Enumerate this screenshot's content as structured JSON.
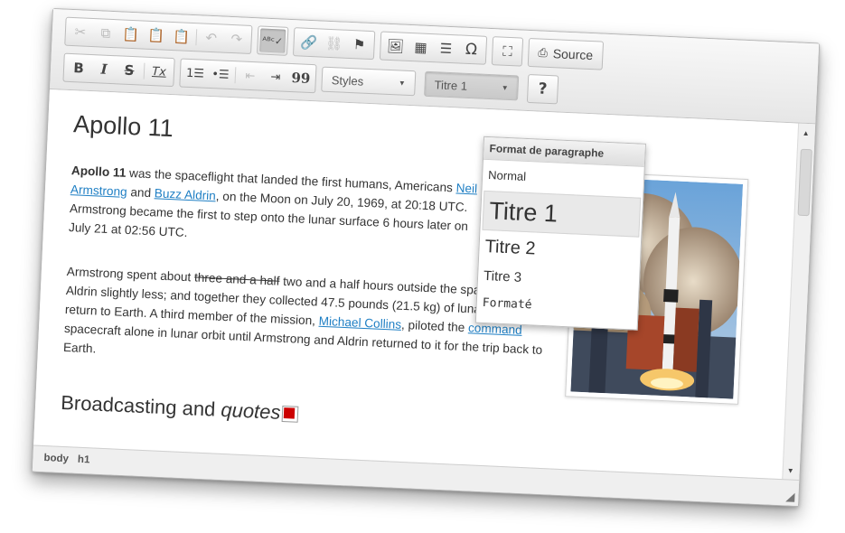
{
  "toolbar": {
    "row1_groups": [
      {
        "icons": [
          "cut-icon",
          "copy-icon",
          "paste-icon",
          "paste-text-icon",
          "paste-word-icon",
          "undo-icon",
          "redo-icon"
        ]
      },
      {
        "icons": [
          "spellcheck-icon"
        ]
      },
      {
        "icons": [
          "link-icon",
          "unlink-icon",
          "anchor-icon"
        ]
      },
      {
        "icons": [
          "image-icon",
          "table-icon",
          "horizontal-rule-icon",
          "special-char-icon"
        ]
      },
      {
        "icons": [
          "maximize-icon"
        ]
      }
    ],
    "bold": "B",
    "italic": "I",
    "strike": "S",
    "remove_format": "Tx",
    "blockquote": "99",
    "source_label": "Source",
    "styles_label": "Styles",
    "format_label": "Titre 1",
    "help_label": "?"
  },
  "content": {
    "heading": "Apollo 11",
    "p1_bold": "Apollo 11",
    "p1_a": " was the spaceflight that landed the first humans, Americans ",
    "p1_link1": "Neil Armstrong",
    "p1_b": " and ",
    "p1_link2": "Buzz Aldrin",
    "p1_c": ", on the Moon on July 20, 1969, at 20:18 UTC. Armstrong became the first to step onto the lunar surface 6 hours later on July 21 at 02:56 UTC.",
    "p2_a": "Armstrong spent about ",
    "p2_strike": "three and a half",
    "p2_b": " two and a half hours outside the spacecraft, Aldrin slightly less; and together they collected 47.5 pounds (21.5 kg) of lunar material for return to Earth. A third member of the mission, ",
    "p2_link1": "Michael Collins",
    "p2_c": ", piloted the ",
    "p2_link2": "command",
    "p2_d": " spacecraft alone in lunar orbit until Armstrong and Aldrin returned to it for the trip back to Earth.",
    "h2_a": "Broadcasting and ",
    "h2_b": "quotes"
  },
  "dropdown": {
    "title": "Format de paragraphe",
    "items": [
      "Normal",
      "Titre 1",
      "Titre 2",
      "Titre 3",
      "Formaté"
    ]
  },
  "status": {
    "path": [
      "body",
      "h1"
    ]
  },
  "colors": {
    "link": "#1f7fc4",
    "toolbar": "#ececec"
  }
}
